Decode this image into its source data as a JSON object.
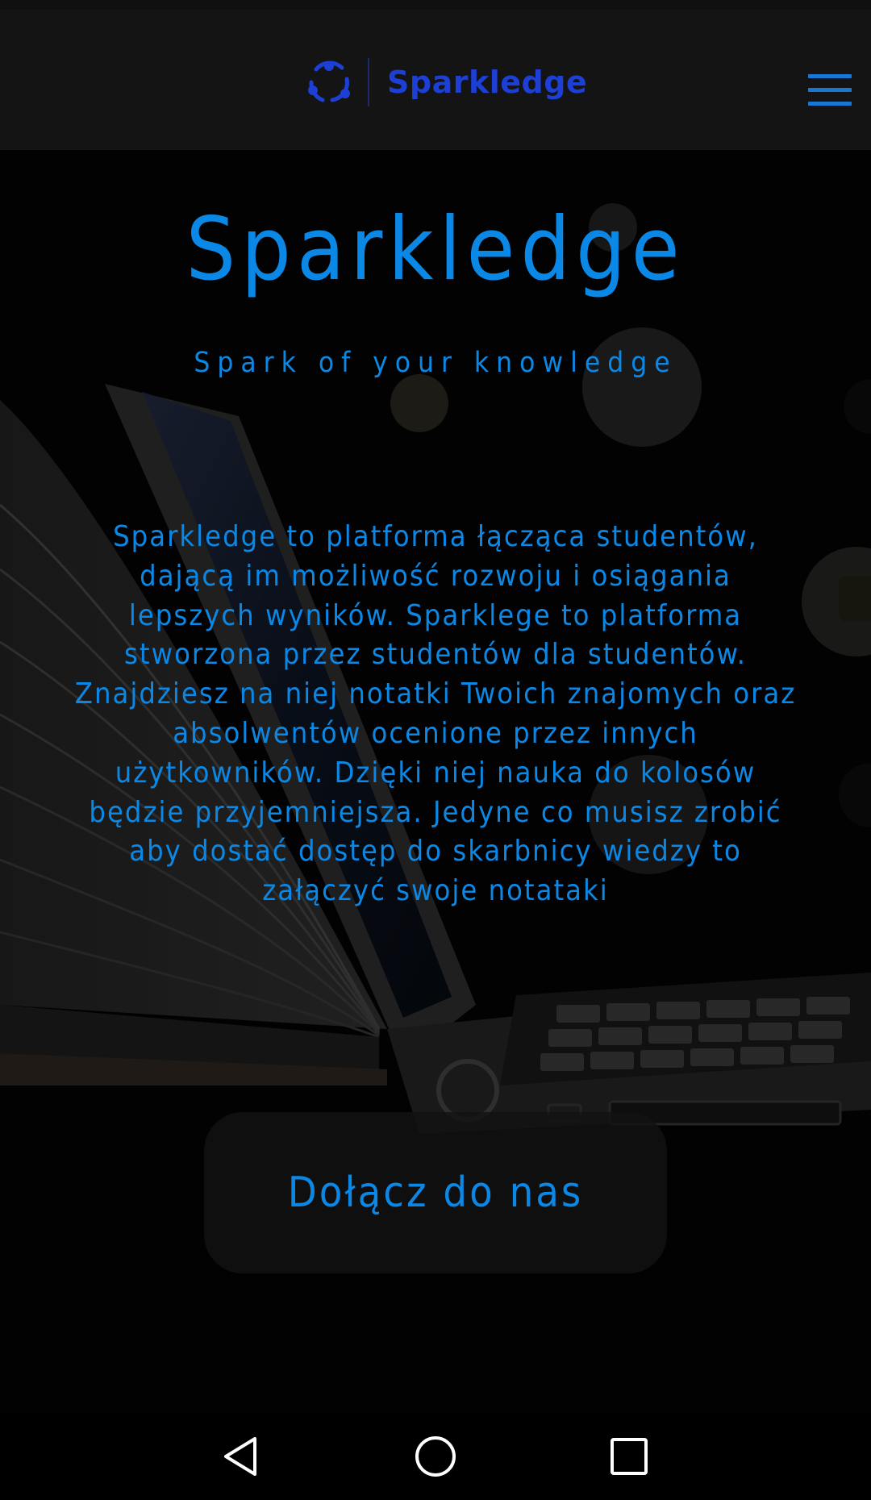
{
  "header": {
    "brand_name": "Sparkledge",
    "logo_icon": "sparkledge-logo-icon",
    "menu_icon": "hamburger-menu-icon",
    "accent_color": "#1d3fd6"
  },
  "hero": {
    "title": "Sparkledge",
    "tagline": "Spark of your knowledge",
    "description": "Sparkledge to platforma łącząca studentów, dającą im możliwość rozwoju i osiągania lepszych wyników. Sparklege to platforma stworzona przez studentów dla studentów. Znajdziesz na niej notatki Twoich znajomych oraz absolwentów ocenione przez innych użytkowników. Dzięki niej nauka do kolosów będzie przyjemniejsza. Jedyne co musisz zrobić aby dostać dostęp do skarbnicy wiedzy to załączyć swoje notataki",
    "join_button_label": "Dołącz do nas",
    "text_color": "#0b88e6",
    "background_icon": "laptop-book-illustration"
  },
  "system_nav": {
    "back_icon": "back-triangle-icon",
    "home_icon": "home-circle-icon",
    "recents_icon": "recents-square-icon"
  }
}
